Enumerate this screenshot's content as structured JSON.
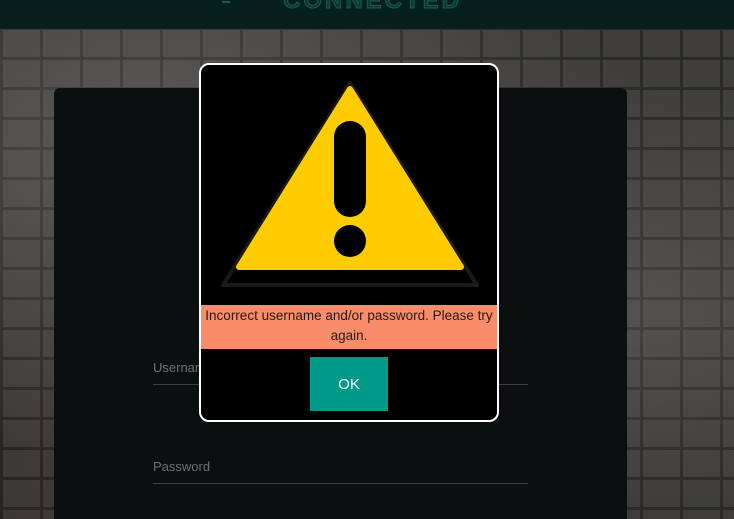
{
  "header": {
    "title": "CONNECTED"
  },
  "login": {
    "username_placeholder": "Username",
    "password_placeholder": "Password"
  },
  "dialog": {
    "icon": "warning-triangle-icon",
    "message": "Incorrect username and/or password. Please try again.",
    "ok_label": "OK"
  },
  "colors": {
    "topbar_bg": "#05201d",
    "panel_bg": "#0b0f0f",
    "warning_yellow": "#ffcc00",
    "error_band": "#f98c6a",
    "ok_button": "#009a88"
  }
}
